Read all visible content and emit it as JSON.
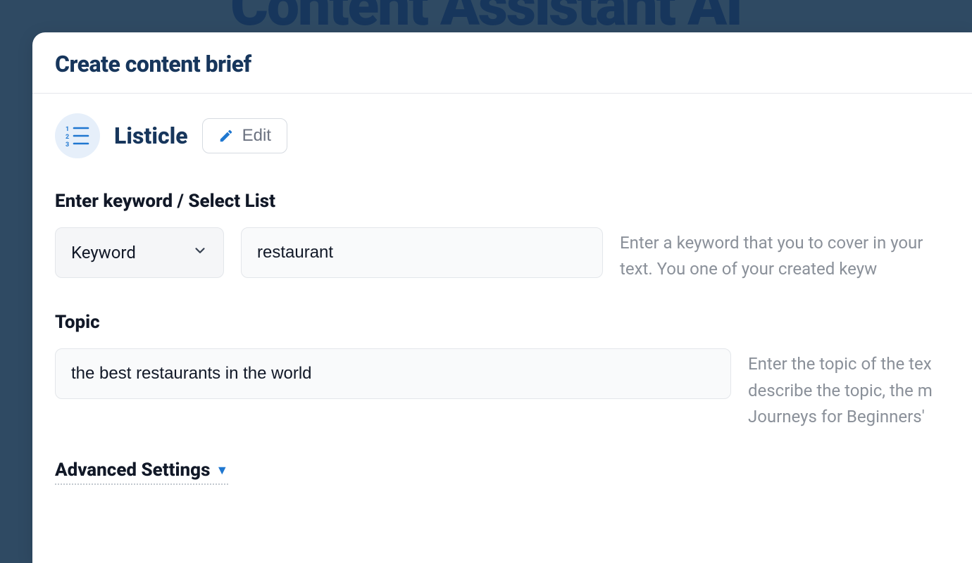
{
  "background": {
    "title": "Content Assistant AI"
  },
  "panel": {
    "header_title": "Create content brief",
    "content_type": {
      "icon": "list-numbered-icon",
      "label": "Listicle",
      "edit_label": "Edit"
    },
    "keyword_section": {
      "label": "Enter keyword / Select List",
      "selector_value": "Keyword",
      "input_value": "restaurant",
      "help": "Enter a keyword that you to cover in your text. You one of your created keyw"
    },
    "topic_section": {
      "label": "Topic",
      "input_value": "the best restaurants in the world",
      "help": "Enter the topic of the tex describe the topic, the m Journeys for Beginners'"
    },
    "advanced_label": "Advanced Settings"
  }
}
